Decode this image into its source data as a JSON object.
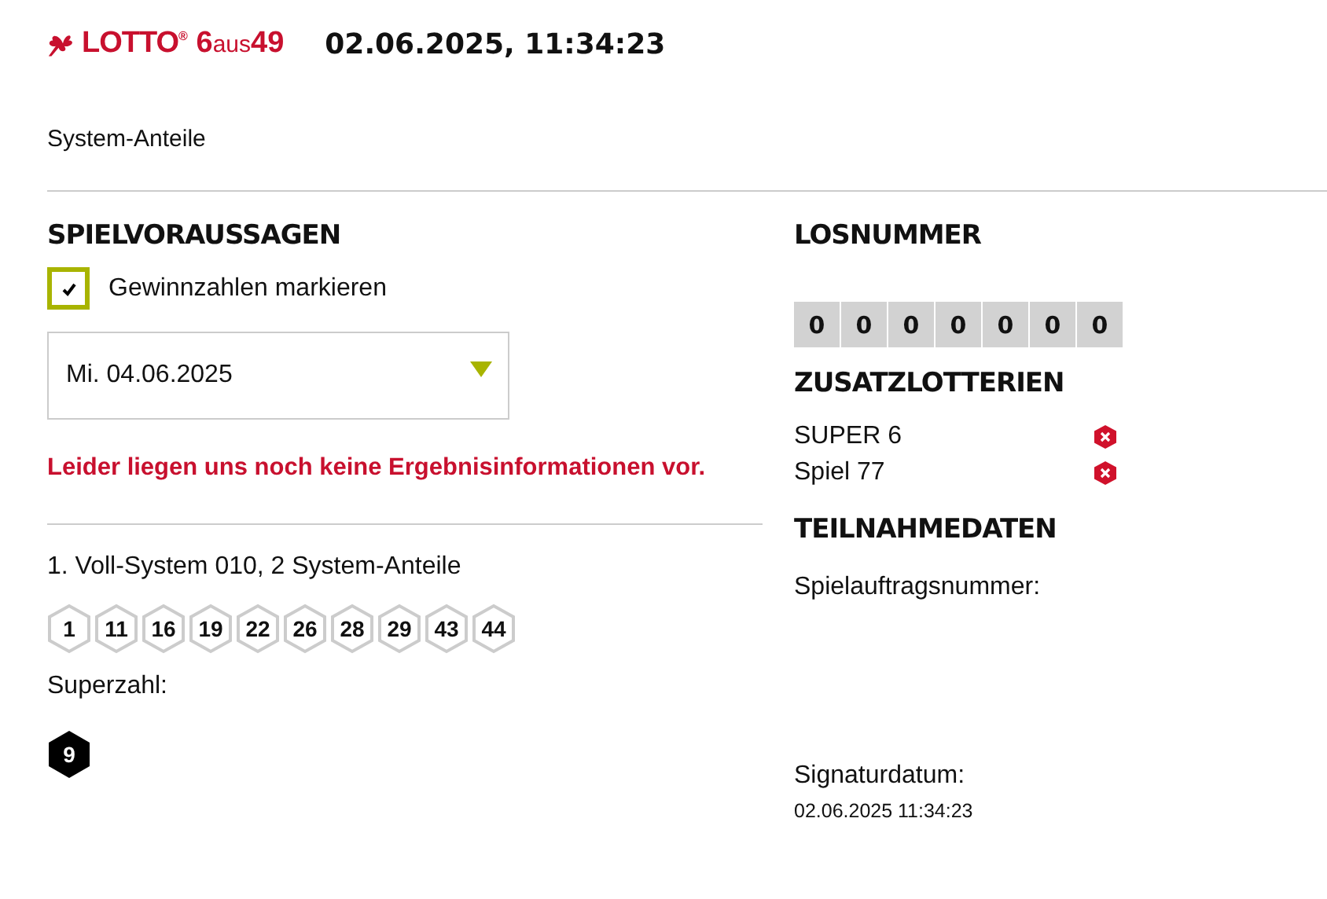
{
  "header": {
    "logo": {
      "brand": "LOTTO",
      "mark": "®",
      "game_number": "6",
      "game_word": "aus",
      "game_max": "49"
    },
    "timestamp": "02.06.2025, 11:34:23"
  },
  "subtitle": "System-Anteile",
  "predictions": {
    "title": "SPIELVORAUSSAGEN",
    "mark_winners": {
      "label": "Gewinnzahlen markieren",
      "checked": true
    },
    "draw_date": {
      "value": "Mi. 04.06.2025"
    },
    "notice": "Leider liegen uns noch keine Ergebnisinformationen vor.",
    "system": "1. Voll-System 010, 2 System-Anteile",
    "numbers": [
      "1",
      "11",
      "16",
      "19",
      "22",
      "26",
      "28",
      "29",
      "43",
      "44"
    ],
    "superzahl_label": "Superzahl:",
    "superzahl": "9"
  },
  "ticket_number": {
    "title": "LOSNUMMER",
    "digits": [
      "0",
      "0",
      "0",
      "0",
      "0",
      "0",
      "0"
    ]
  },
  "extra_lotteries": {
    "title": "ZUSATZLOTTERIEN",
    "items": [
      {
        "name": "SUPER 6",
        "active": false
      },
      {
        "name": "Spiel 77",
        "active": false
      }
    ]
  },
  "participation": {
    "title": "TEILNAHMEDATEN",
    "order_number_label": "Spielauftragsnummer:",
    "signature_label": "Signaturdatum:",
    "signature_date": "02.06.2025 11:34:23"
  }
}
